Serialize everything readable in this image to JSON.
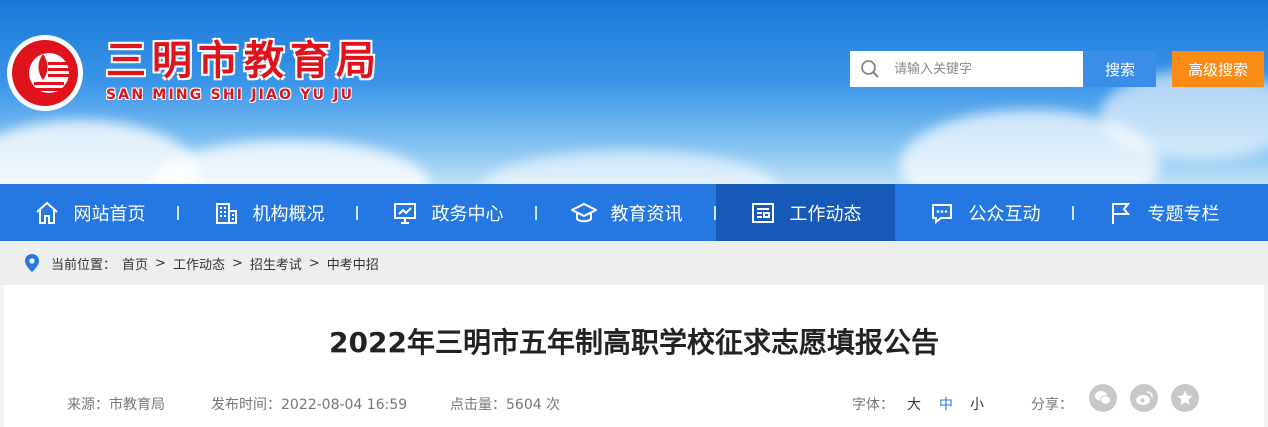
{
  "header": {
    "site_name_cn": "三明市教育局",
    "site_name_en": "SAN MING SHI JIAO YU JU",
    "search_placeholder": "请输入关键字",
    "search_button": "搜索",
    "advanced_search_button": "高级搜索"
  },
  "nav": {
    "items": [
      {
        "label": "网站首页",
        "icon": "home-icon"
      },
      {
        "label": "机构概况",
        "icon": "building-icon"
      },
      {
        "label": "政务中心",
        "icon": "presentation-icon"
      },
      {
        "label": "教育资讯",
        "icon": "graduation-cap-icon"
      },
      {
        "label": "工作动态",
        "icon": "newspaper-icon",
        "active": true
      },
      {
        "label": "公众互动",
        "icon": "chat-icon"
      },
      {
        "label": "专题专栏",
        "icon": "flag-icon"
      }
    ]
  },
  "breadcrumb": {
    "prefix": "当前位置：",
    "items": [
      "首页",
      "工作动态",
      "招生考试",
      "中考中招"
    ],
    "separator": ">"
  },
  "article": {
    "title": "2022年三明市五年制高职学校征求志愿填报公告",
    "source": "来源：市教育局",
    "publish_time": "发布时间：2022-08-04 16:59",
    "hits": "点击量：5604 次",
    "font_label": "字体：",
    "font_large": "大",
    "font_medium": "中",
    "font_small": "小",
    "share_label": "分享："
  },
  "colors": {
    "nav_bg": "#2578e1",
    "nav_active": "#1659b8",
    "brand_red": "#e0121b",
    "search_btn": "#3b8ee8",
    "advanced_btn": "#fa8b14"
  }
}
